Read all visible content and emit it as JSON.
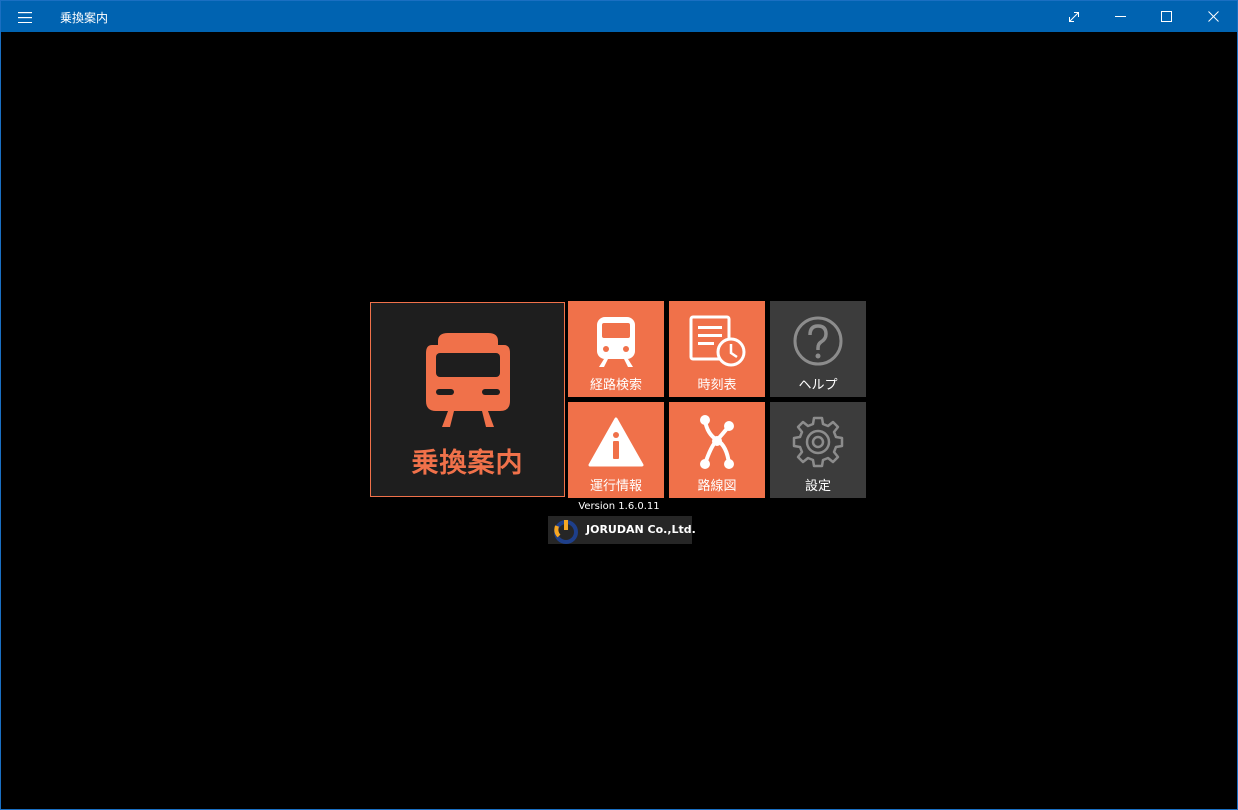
{
  "window": {
    "title": "乗換案内"
  },
  "main_tile": {
    "label": "乗換案内"
  },
  "tiles": [
    {
      "label": "経路検索",
      "icon": "train-front-icon"
    },
    {
      "label": "時刻表",
      "icon": "timetable-clock-icon"
    },
    {
      "label": "ヘルプ",
      "icon": "help-question-icon"
    },
    {
      "label": "運行情報",
      "icon": "warning-info-icon"
    },
    {
      "label": "路線図",
      "icon": "route-map-icon"
    },
    {
      "label": "設定",
      "icon": "gear-icon"
    }
  ],
  "footer": {
    "version": "Version 1.6.0.11",
    "company": "JORUDAN Co.,Ltd."
  },
  "colors": {
    "titlebar": "#0063b1",
    "accent": "#f0714a",
    "tile_gray": "#3c3c3c",
    "main_tile_bg": "#1e1e1e",
    "background": "#000000"
  }
}
